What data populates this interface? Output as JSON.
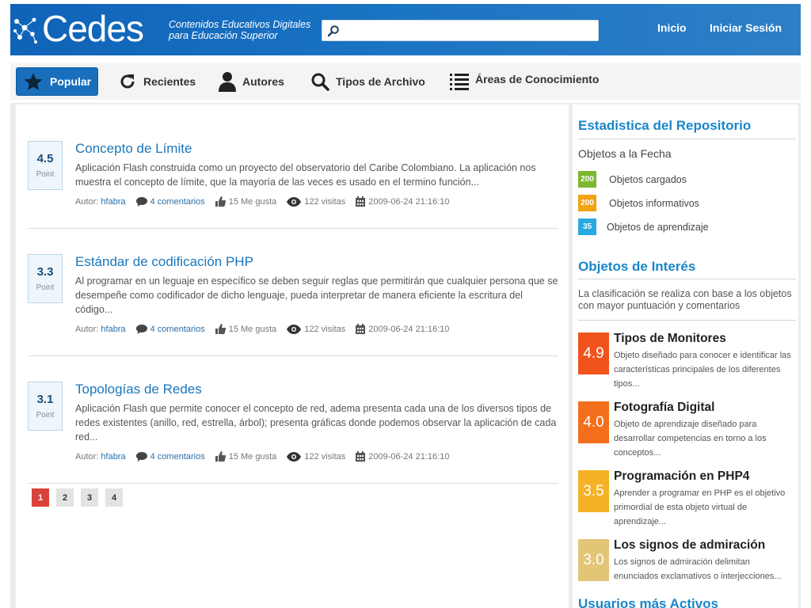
{
  "header": {
    "logo_text": "Cedes",
    "tagline_line1": "Contenidos Educativos Digitales",
    "tagline_line2": "para Educación Superior",
    "search_value": "",
    "search_icon": "search-icon",
    "nav_inicio": "Inicio",
    "nav_sesion": "Iniciar Sesión"
  },
  "tabs": [
    {
      "label": "Popular",
      "icon": "star-icon",
      "active": true
    },
    {
      "label": "Recientes",
      "icon": "refresh-icon"
    },
    {
      "label": "Autores",
      "icon": "user-icon"
    },
    {
      "label": "Tipos de Archivo",
      "icon": "search-icon"
    },
    {
      "label": "Áreas de Conocimiento",
      "icon": "list-icon"
    }
  ],
  "articles": [
    {
      "score": "4.5",
      "score_label": "Point",
      "title": "Concepto de Límite",
      "desc": "Aplicación Flash construida como un proyecto del observatorio del Caribe Colombiano. La aplicación nos muestra el concepto de límite, que la mayoría de las veces es usado en el termino función...",
      "author_label": "Autor:",
      "author": "hfabra",
      "comments": "4 comentarios",
      "likes": "15 Me gusta",
      "visits": "122 visitas",
      "date": "2009-06-24 21:16:10"
    },
    {
      "score": "3.3",
      "score_label": "Point",
      "title": "Estándar de codificación PHP",
      "desc": "Al programar en un leguaje en específico se deben seguir reglas que permitirán que cualquier persona que se desempeñe como codificador de dicho lenguaje, pueda interpretar de manera eficiente la escritura del código...",
      "author_label": "Autor:",
      "author": "hfabra",
      "comments": "4 comentarios",
      "likes": "15 Me gusta",
      "visits": "122 visitas",
      "date": "2009-06-24 21:16:10"
    },
    {
      "score": "3.1",
      "score_label": "Point",
      "title": "Topologías de Redes",
      "desc": "Aplicación Flash que permite conocer el concepto de red, adema presenta cada una de los diversos tipos de redes existentes (anillo, red, estrella, árbol); presenta gráficas donde podemos observar la aplicación de cada red...",
      "author_label": "Autor:",
      "author": "hfabra",
      "comments": "4 comentarios",
      "likes": "15 Me gusta",
      "visits": "122 visitas",
      "date": "2009-06-24 21:16:10"
    }
  ],
  "pagination": {
    "pages": [
      "1",
      "2",
      "3",
      "4"
    ],
    "current": "1"
  },
  "sidebar": {
    "stats_title": "Estadistica del Repositorio",
    "stats_subtitle": "Objetos a la Fecha",
    "stats": [
      {
        "count": "200",
        "label": "Objetos cargados",
        "color": "#7cb82f"
      },
      {
        "count": "200",
        "label": "Objetos informativos",
        "color": "#f2a30f"
      },
      {
        "count": "35",
        "label": "Objetos de aprendizaje",
        "color": "#29a9e1"
      }
    ],
    "interest_title": "Objetos de Interés",
    "interest_note": "La clasificación se realiza con base a los objetos con mayor puntuación y comentarios",
    "interest": [
      {
        "score": "4.9",
        "title": "Tipos de Monitores",
        "desc": "Objeto diseñado para conocer e identificar las características principales de los diferentes tipos...",
        "color": "#f0531c"
      },
      {
        "score": "4.0",
        "title": "Fotografía Digital",
        "desc": "Objeto de aprendizaje diseñado para desarrollar competencias en torno a los conceptos...",
        "color": "#f36f1c"
      },
      {
        "score": "3.5",
        "title": "Programación en PHP4",
        "desc": "Aprender a programar en PHP es el objetivo primordial de esta objeto virtual de aprendizaje...",
        "color": "#f5b226"
      },
      {
        "score": "3.0",
        "title": "Los signos de admiración",
        "desc": "Los signos de admiración delimitan enunciados exclamativos o interjecciones...",
        "color": "#e3c578"
      }
    ],
    "users_title": "Usuarios más Activos"
  }
}
